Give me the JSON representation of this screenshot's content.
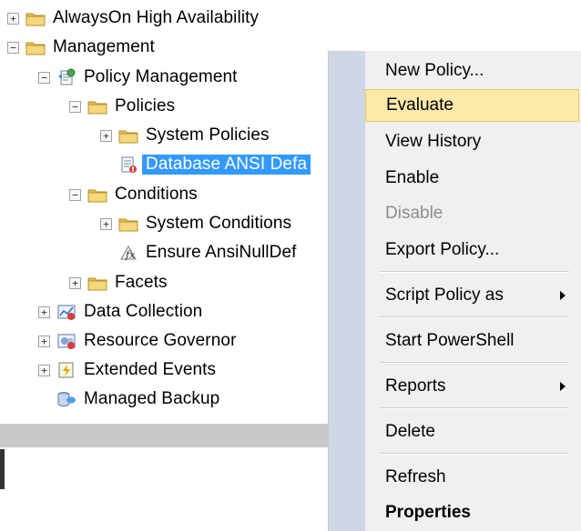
{
  "tree": {
    "items": [
      {
        "label": "AlwaysOn High Availability",
        "expander": "+",
        "icon": "folder-icon"
      },
      {
        "label": "Management",
        "expander": "−",
        "icon": "folder-icon"
      },
      {
        "label": "Policy Management",
        "expander": "−",
        "icon": "policy-management-icon"
      },
      {
        "label": "Policies",
        "expander": "−",
        "icon": "folder-icon"
      },
      {
        "label": "System Policies",
        "expander": "+",
        "icon": "folder-icon"
      },
      {
        "label": "Database ANSI Defa",
        "expander": "",
        "icon": "policy-icon",
        "selected": true
      },
      {
        "label": "Conditions",
        "expander": "−",
        "icon": "folder-icon"
      },
      {
        "label": "System Conditions",
        "expander": "+",
        "icon": "folder-icon"
      },
      {
        "label": "Ensure AnsiNullDef",
        "expander": "",
        "icon": "condition-icon"
      },
      {
        "label": "Facets",
        "expander": "+",
        "icon": "folder-icon"
      },
      {
        "label": "Data Collection",
        "expander": "+",
        "icon": "data-collection-icon"
      },
      {
        "label": "Resource Governor",
        "expander": "+",
        "icon": "resource-governor-icon"
      },
      {
        "label": "Extended Events",
        "expander": "+",
        "icon": "extended-events-icon"
      },
      {
        "label": "Managed Backup",
        "expander": "",
        "icon": "managed-backup-icon"
      }
    ]
  },
  "context_menu": {
    "items": [
      {
        "label": "New Policy...",
        "state": "normal"
      },
      {
        "label": "Evaluate",
        "state": "highlighted"
      },
      {
        "label": "View History",
        "state": "normal"
      },
      {
        "label": "Enable",
        "state": "normal"
      },
      {
        "label": "Disable",
        "state": "disabled"
      },
      {
        "label": "Export Policy...",
        "state": "normal"
      },
      {
        "label": "Script Policy as",
        "state": "submenu"
      },
      {
        "label": "Start PowerShell",
        "state": "normal"
      },
      {
        "label": "Reports",
        "state": "submenu"
      },
      {
        "label": "Delete",
        "state": "normal"
      },
      {
        "label": "Refresh",
        "state": "normal"
      },
      {
        "label": "Properties",
        "state": "bold"
      }
    ]
  },
  "colors": {
    "selection": "#3399ff",
    "menu_highlight": "#fce9a9",
    "menu_gutter": "#cfd6e6",
    "folder": "#e8c15a"
  }
}
